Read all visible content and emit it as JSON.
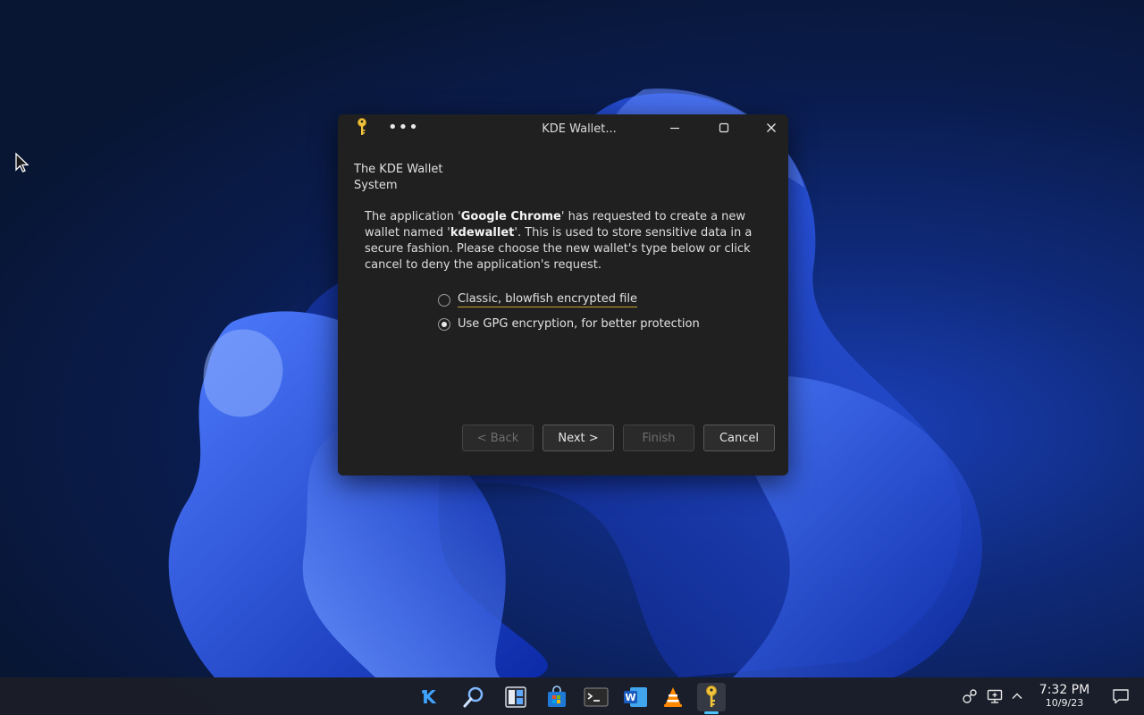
{
  "dialog": {
    "title": "KDE Wallet...",
    "header": "The KDE Wallet System",
    "message": {
      "part1": "The application '",
      "app_name": "Google Chrome",
      "part2": "' has requested to create a new wallet named '",
      "wallet_name": "kdewallet",
      "part3": "'. This is used to store sensitive data in a secure fashion. Please choose the new wallet's type below or click cancel to deny the application's request."
    },
    "options": [
      {
        "label": "Classic, blowfish encrypted file",
        "checked": false
      },
      {
        "label": "Use GPG encryption, for better protection",
        "checked": true
      }
    ],
    "buttons": {
      "back": "< Back",
      "next": "Next >",
      "finish": "Finish",
      "cancel": "Cancel"
    }
  },
  "taskbar": {
    "apps": [
      "kde-icon",
      "search-icon",
      "window-manager-icon",
      "store-icon",
      "terminal-icon",
      "word-icon",
      "vlc-icon",
      "kwallet-icon"
    ],
    "clock": {
      "time": "7:32 PM",
      "date": "10/9/23"
    }
  },
  "colors": {
    "accent": "#4cc2ff",
    "dialog_bg": "#202020",
    "focus_underline": "#c8a030"
  }
}
